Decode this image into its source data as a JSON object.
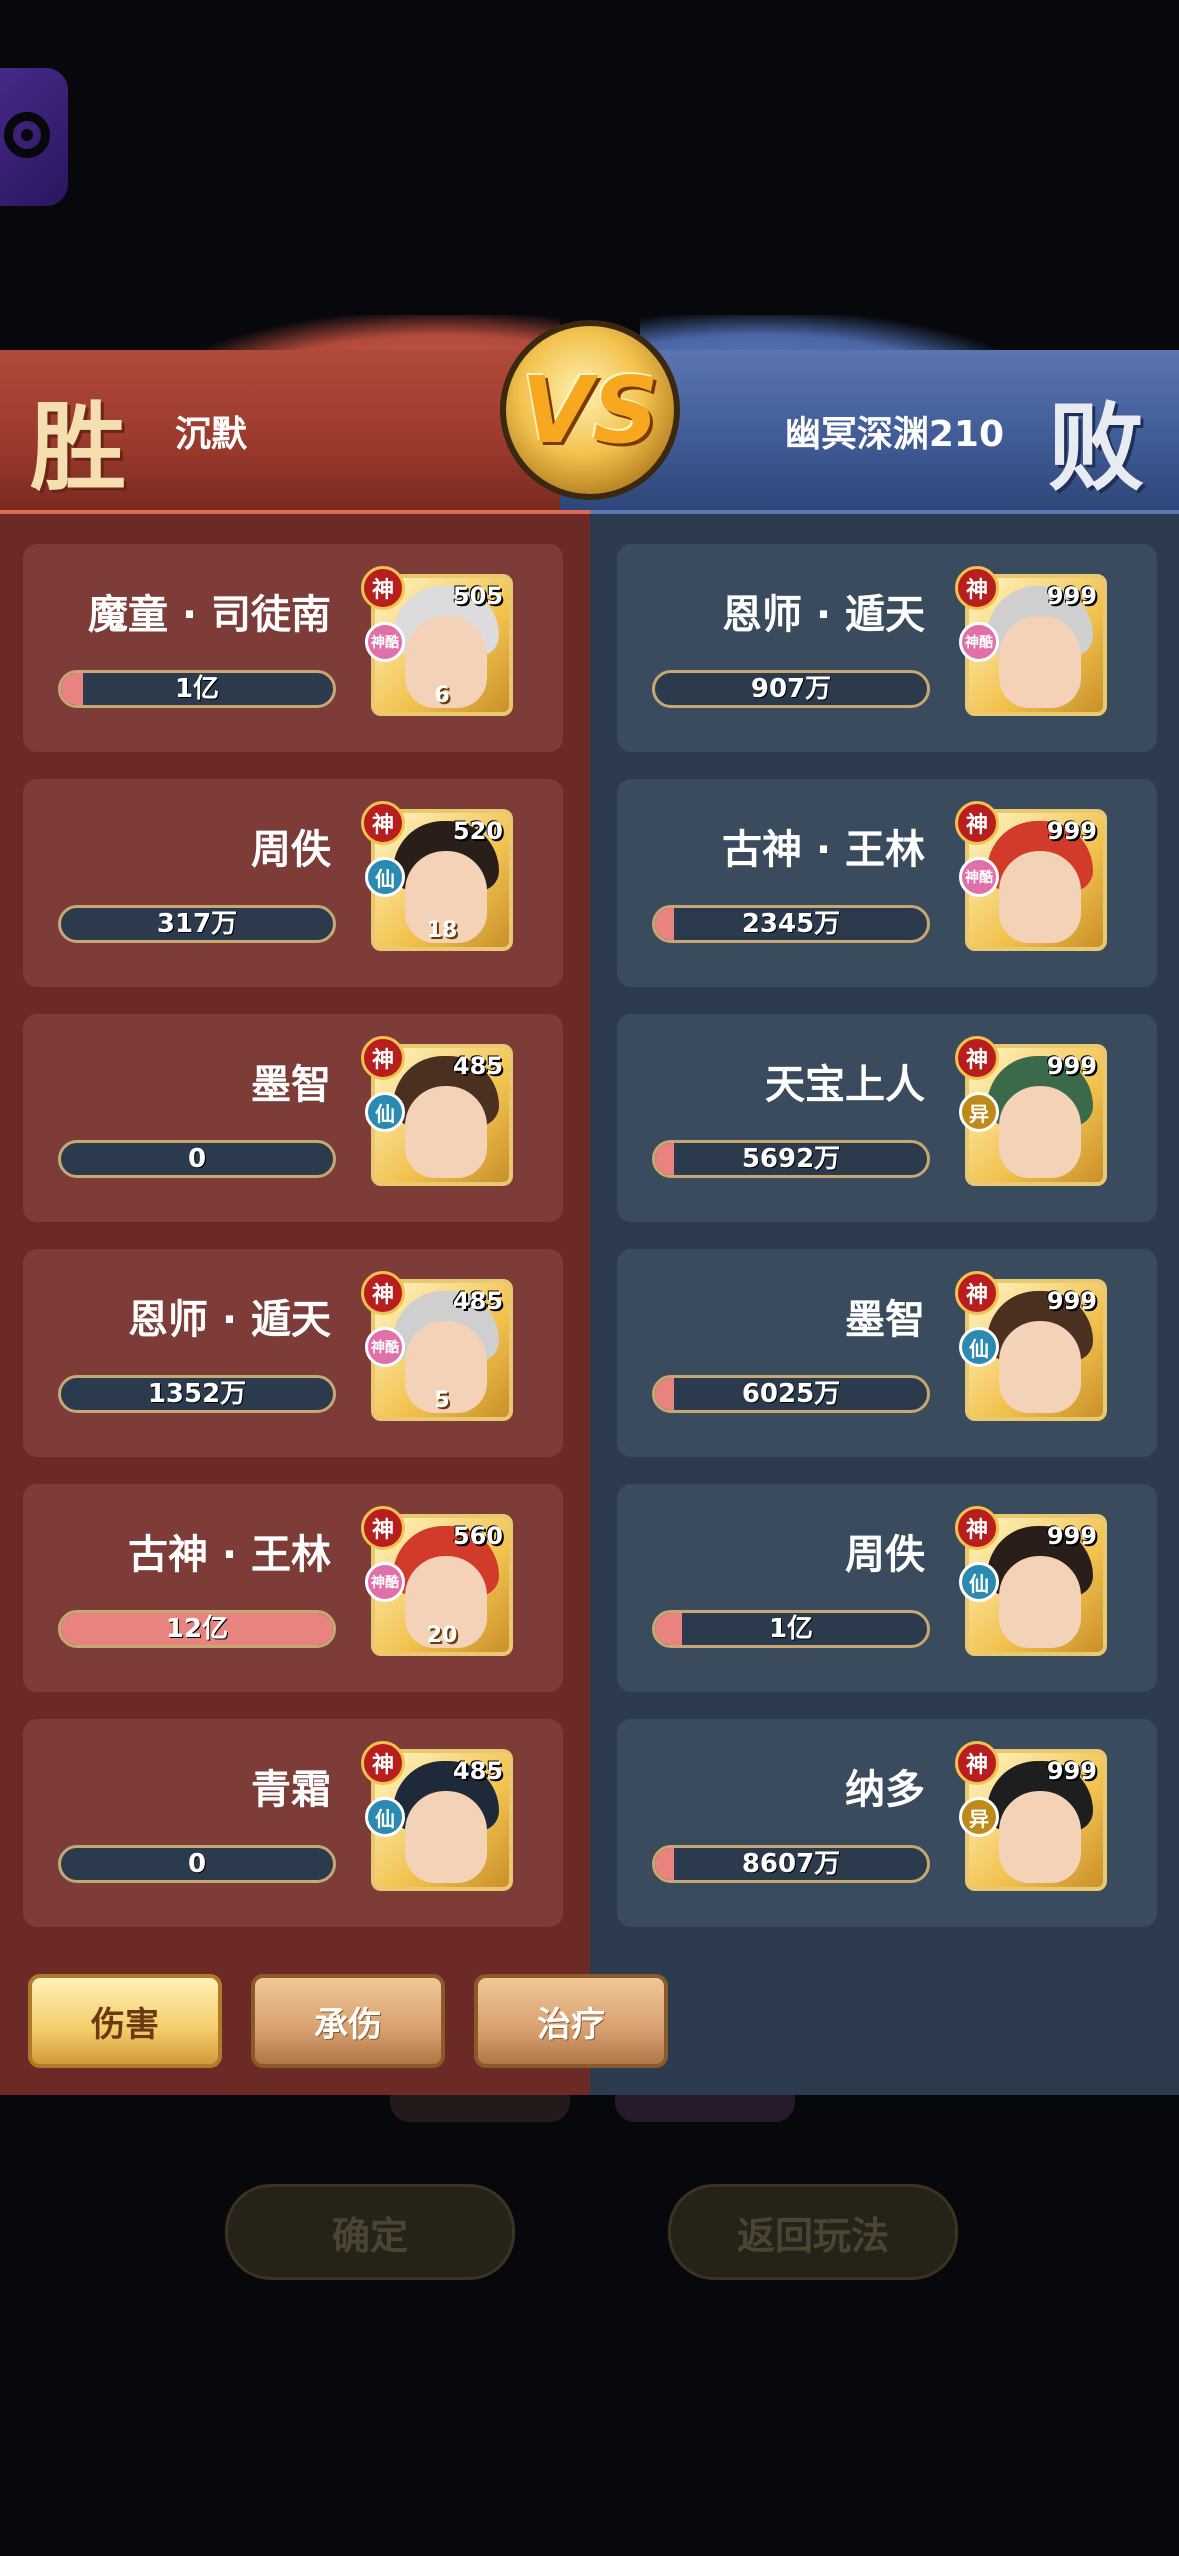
{
  "header": {
    "left_result": "胜",
    "right_result": "败",
    "left_player": "沉默",
    "right_player": "幽冥深渊210",
    "vs_label": "VS"
  },
  "left_team": [
    {
      "name": "魔童 · 司徒南",
      "value": "1亿",
      "fill": 0.08,
      "level": "505",
      "badge": "神",
      "type": "神酷",
      "star": "6",
      "hair": "#dcdcdc"
    },
    {
      "name": "周佚",
      "value": "317万",
      "fill": 0.0,
      "level": "520",
      "badge": "神",
      "type": "仙",
      "star": "18",
      "hair": "#2a1e1a"
    },
    {
      "name": "墨智",
      "value": "0",
      "fill": 0.0,
      "level": "485",
      "badge": "神",
      "type": "仙",
      "star": "",
      "hair": "#4a3020"
    },
    {
      "name": "恩师 · 遁天",
      "value": "1352万",
      "fill": 0.0,
      "level": "485",
      "badge": "神",
      "type": "神酷",
      "star": "5",
      "hair": "#cfcfcf"
    },
    {
      "name": "古神 · 王林",
      "value": "12亿",
      "fill": 1.0,
      "level": "560",
      "badge": "神",
      "type": "神酷",
      "star": "20",
      "hair": "#d23a2a"
    },
    {
      "name": "青霜",
      "value": "0",
      "fill": 0.0,
      "level": "485",
      "badge": "神",
      "type": "仙",
      "star": "",
      "hair": "#1e2a3a"
    }
  ],
  "right_team": [
    {
      "name": "恩师 · 遁天",
      "value": "907万",
      "fill": 0.0,
      "level": "999",
      "badge": "神",
      "type": "神酷",
      "star": "",
      "hair": "#cfcfcf"
    },
    {
      "name": "古神 · 王林",
      "value": "2345万",
      "fill": 0.02,
      "level": "999",
      "badge": "神",
      "type": "神酷",
      "star": "",
      "hair": "#d23a2a"
    },
    {
      "name": "天宝上人",
      "value": "5692万",
      "fill": 0.05,
      "level": "999",
      "badge": "神",
      "type": "异",
      "star": "",
      "hair": "#3a6a4a"
    },
    {
      "name": "墨智",
      "value": "6025万",
      "fill": 0.05,
      "level": "999",
      "badge": "神",
      "type": "仙",
      "star": "",
      "hair": "#4a3020"
    },
    {
      "name": "周佚",
      "value": "1亿",
      "fill": 0.1,
      "level": "999",
      "badge": "神",
      "type": "仙",
      "star": "",
      "hair": "#2a1e1a"
    },
    {
      "name": "纳多",
      "value": "8607万",
      "fill": 0.07,
      "level": "999",
      "badge": "神",
      "type": "异",
      "star": "",
      "hair": "#1e1e1e"
    }
  ],
  "tabs": [
    {
      "label": "伤害",
      "active": true
    },
    {
      "label": "承伤",
      "active": false
    },
    {
      "label": "治疗",
      "active": false
    }
  ],
  "background_buttons": {
    "confirm": "确定",
    "return": "返回玩法"
  },
  "colors": {
    "win_red": "#6b2a25",
    "lose_blue": "#2c3b4e",
    "bar_fill": "#e8837f",
    "accent_gold": "#f2c24e"
  }
}
